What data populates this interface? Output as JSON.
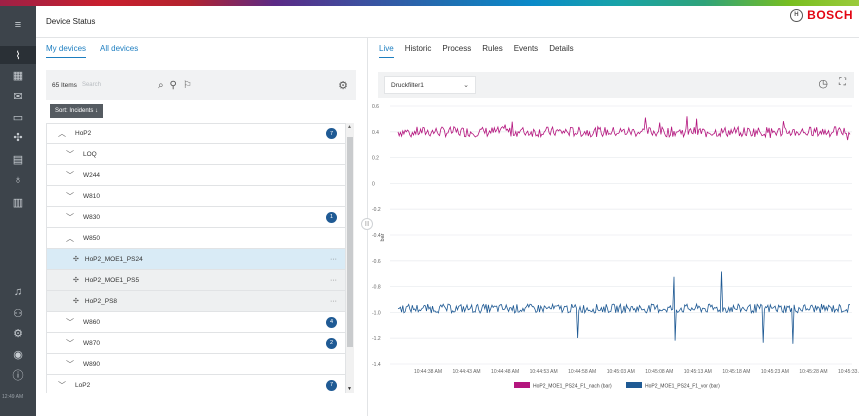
{
  "header": {
    "title": "Device Status",
    "brand": "BOSCH"
  },
  "rail": {
    "time": "12:49 AM"
  },
  "left": {
    "tabs": [
      {
        "label": "My devices",
        "active": true
      },
      {
        "label": "All devices",
        "active": false
      }
    ],
    "item_count": "65 Items",
    "search_placeholder": "Search",
    "sort_label": "Sort: Incidents ↓",
    "tree": [
      {
        "label": "HoP2",
        "level": 0,
        "expanded": true,
        "badge": "7"
      },
      {
        "label": "LOQ",
        "level": 1,
        "expanded": false
      },
      {
        "label": "W244",
        "level": 1,
        "expanded": false
      },
      {
        "label": "W810",
        "level": 1,
        "expanded": false
      },
      {
        "label": "W830",
        "level": 1,
        "expanded": false,
        "badge": "1"
      },
      {
        "label": "W850",
        "level": 1,
        "expanded": true
      },
      {
        "label": "HoP2_MOE1_PS24",
        "level": 2,
        "selected": true,
        "device": true
      },
      {
        "label": "HoP2_MOE1_PS5",
        "level": 2,
        "device": true
      },
      {
        "label": "HoP2_PS8",
        "level": 2,
        "device": true
      },
      {
        "label": "W860",
        "level": 1,
        "expanded": false,
        "badge": "4"
      },
      {
        "label": "W870",
        "level": 1,
        "expanded": false,
        "badge": "2"
      },
      {
        "label": "W890",
        "level": 1,
        "expanded": false
      },
      {
        "label": "LoP2",
        "level": 0,
        "expanded": false,
        "badge": "7"
      }
    ]
  },
  "right": {
    "tabs": [
      {
        "label": "Live",
        "active": true
      },
      {
        "label": "Historic"
      },
      {
        "label": "Process"
      },
      {
        "label": "Rules"
      },
      {
        "label": "Events"
      },
      {
        "label": "Details"
      }
    ],
    "selected_filter": "Druckfilter1"
  },
  "chart_data": {
    "type": "line",
    "ylabel": "bar",
    "ylim": [
      -1.4,
      0.6
    ],
    "yticks": [
      "0.6",
      "0.4",
      "0.2",
      "0",
      "-0.2",
      "-0.4",
      "-0.6",
      "-0.8",
      "-1.0",
      "-1.2",
      "-1.4"
    ],
    "xticks": [
      "10:44:38 AM",
      "10:44:43 AM",
      "10:44:48 AM",
      "10:44:53 AM",
      "10:44:58 AM",
      "10:45:03 AM",
      "10:45:08 AM",
      "10:45:13 AM",
      "10:45:18 AM",
      "10:45:23 AM",
      "10:45:28 AM",
      "10:45:33 AM"
    ],
    "series": [
      {
        "name": "HoP2_MOE1_PS24_F1_nach (bar)",
        "color": "#b4167e",
        "mean": 0.4,
        "min": 0.32,
        "max": 0.52
      },
      {
        "name": "HoP2_MOE1_PS24_F1_vor (bar)",
        "color": "#1f5a94",
        "mean": -0.97,
        "min": -1.25,
        "max": -0.68
      }
    ],
    "grid": "horizontal",
    "legend": "bottom-center"
  }
}
